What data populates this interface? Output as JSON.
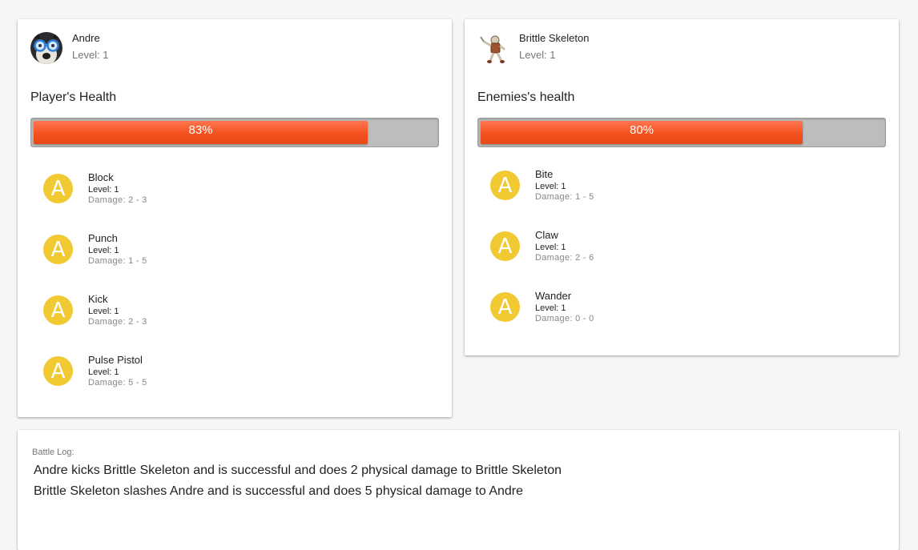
{
  "player": {
    "name": "Andre",
    "level": "Level: 1",
    "health_title": "Player's Health",
    "health_percent": 83,
    "health_label": "83%",
    "skills": [
      {
        "name": "Block",
        "level": "Level: 1",
        "damage": "Damage: 2 - 3",
        "icon": "A"
      },
      {
        "name": "Punch",
        "level": "Level: 1",
        "damage": "Damage: 1 - 5",
        "icon": "A"
      },
      {
        "name": "Kick",
        "level": "Level: 1",
        "damage": "Damage: 2 - 3",
        "icon": "A"
      },
      {
        "name": "Pulse Pistol",
        "level": "Level: 1",
        "damage": "Damage: 5 - 5",
        "icon": "A"
      }
    ]
  },
  "enemy": {
    "name": "Brittle Skeleton",
    "level": "Level: 1",
    "health_title": "Enemies's health",
    "health_percent": 80,
    "health_label": "80%",
    "skills": [
      {
        "name": "Bite",
        "level": "Level: 1",
        "damage": "Damage: 1 - 5",
        "icon": "A"
      },
      {
        "name": "Claw",
        "level": "Level: 1",
        "damage": "Damage: 2 - 6",
        "icon": "A"
      },
      {
        "name": "Wander",
        "level": "Level: 1",
        "damage": "Damage: 0 - 0",
        "icon": "A"
      }
    ]
  },
  "battle_log": {
    "title": "Battle Log:",
    "entries": [
      "Andre kicks Brittle Skeleton and is successful and does 2 physical damage to Brittle Skeleton",
      "Brittle Skeleton slashes Andre and is successful and does 5 physical damage to Andre"
    ]
  },
  "colors": {
    "health_fill": "#f4511e",
    "health_track": "#bdbdbd",
    "skill_icon": "#f1c933"
  }
}
